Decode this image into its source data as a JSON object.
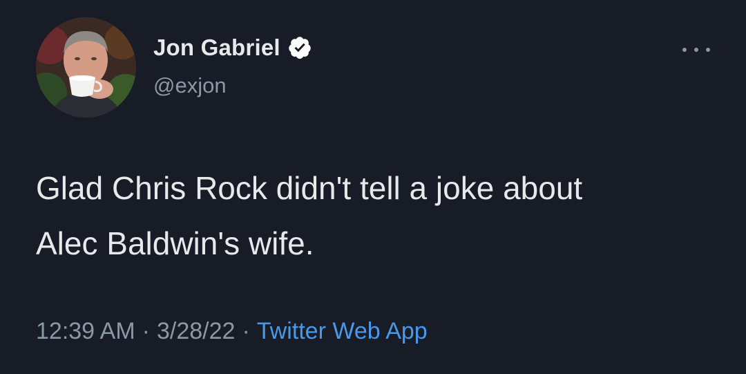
{
  "author": {
    "name": "Jon Gabriel",
    "handle": "@exjon",
    "verified": true
  },
  "tweet": {
    "text": "Glad Chris Rock didn't tell a joke about\nAlec Baldwin's wife.",
    "time": "12:39 AM",
    "date": "3/28/22",
    "source": "Twitter Web App",
    "separator": "·"
  },
  "icons": {
    "verified": "verified-badge-icon",
    "more": "more-options-icon"
  },
  "colors": {
    "background": "#181c27",
    "text": "#e7e9ea",
    "secondary": "#8b98a5",
    "link": "#4a99e9"
  }
}
